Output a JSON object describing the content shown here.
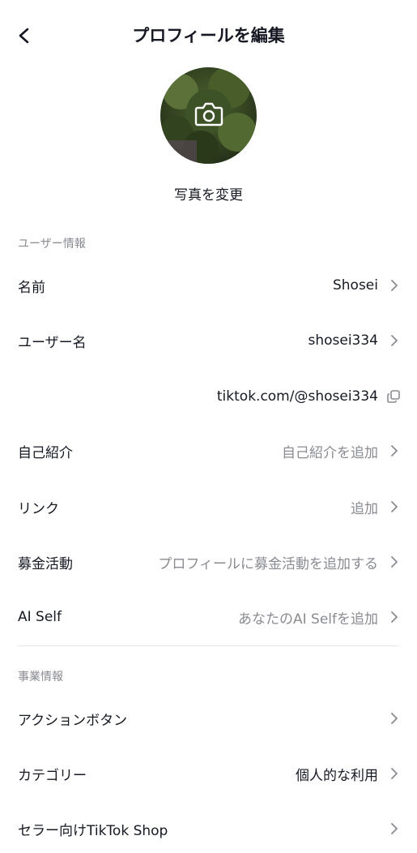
{
  "header": {
    "title": "プロフィールを編集"
  },
  "avatar": {
    "change_label": "写真を変更"
  },
  "sections": {
    "user_info_label": "ユーザー情報",
    "business_info_label": "事業情報"
  },
  "rows": {
    "name": {
      "label": "名前",
      "value": "Shosei"
    },
    "username": {
      "label": "ユーザー名",
      "value": "shosei334"
    },
    "profile_url": {
      "value": "tiktok.com/@shosei334"
    },
    "bio": {
      "label": "自己紹介",
      "value": "自己紹介を追加"
    },
    "link": {
      "label": "リンク",
      "value": "追加"
    },
    "fundraiser": {
      "label": "募金活動",
      "value": "プロフィールに募金活動を追加する"
    },
    "ai_self": {
      "label": "AI Self",
      "value": "あなたのAI Selfを追加"
    },
    "action_button": {
      "label": "アクションボタン",
      "value": ""
    },
    "category": {
      "label": "カテゴリー",
      "value": "個人的な利用"
    },
    "seller_shop": {
      "label": "セラー向けTikTok Shop",
      "value": ""
    }
  },
  "colors": {
    "text": "#161823",
    "secondary": "#8a8b91",
    "divider": "#e6e6e8"
  }
}
